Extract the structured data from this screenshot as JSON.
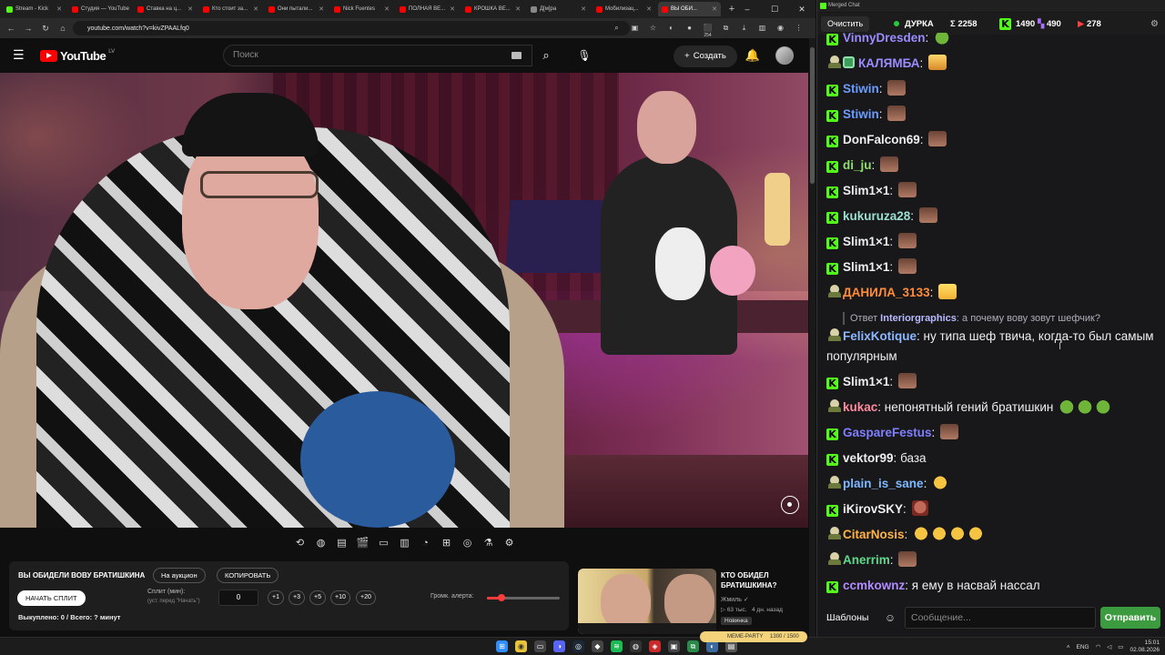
{
  "browser": {
    "tabs": [
      {
        "label": "Stream - Kick",
        "color": "#53fc18"
      },
      {
        "label": "Студия — YouTube",
        "color": "#ff0000"
      },
      {
        "label": "Ставка на ц...",
        "color": "#ff0000"
      },
      {
        "label": "Кто стоит за...",
        "color": "#ff0000"
      },
      {
        "label": "Они пытали...",
        "color": "#ff0000"
      },
      {
        "label": "Nick Fuentes",
        "color": "#ff0000"
      },
      {
        "label": "ПОЛНАЯ ВЕ...",
        "color": "#ff0000"
      },
      {
        "label": "КРОШКА ВЕ...",
        "color": "#ff0000"
      },
      {
        "label": "Д[м]ра",
        "color": "#888888"
      },
      {
        "label": "Мобилизац...",
        "color": "#ff0000"
      },
      {
        "label": "ВЫ ОБИ...",
        "color": "#ff0000"
      }
    ],
    "url": "youtube.com/watch?v=kivZPAALfq0",
    "ext_count": "254"
  },
  "youtube": {
    "logo": "YouTube",
    "country": "LV",
    "search_placeholder": "Поиск",
    "create_label": "Создать"
  },
  "panel": {
    "title": "ВЫ ОБИДЕЛИ ВОВУ БРАТИШКИНА",
    "auction_label": "На аукцион",
    "copy_label": "КОПИРОВАТЬ",
    "start_label": "НАЧАТЬ СПЛИТ",
    "split_label": "Сплит (мин):",
    "split_hint": "(уст. перед \"Начать\")",
    "split_value": "0",
    "steps": [
      "+1",
      "+3",
      "+5",
      "+10",
      "+20"
    ],
    "volume_label": "Громк. алерта:",
    "volume": 0.2,
    "status": "Выкуплено: 0 / Всего: ? минут"
  },
  "recommendation": {
    "title": "КТО ОБИДЕЛ БРАТИШКИНА?",
    "channel": "Жмиль",
    "views": "63 тыс.",
    "age": "4 дн. назад",
    "badge": "Новинка"
  },
  "chat": {
    "window_title": "Merged Chat",
    "clear_label": "Очистить",
    "channel": "ДУРКА",
    "total": "Σ 2258",
    "kick": "1490",
    "twitch": "490",
    "other": "278",
    "templates_label": "Шаблоны",
    "input_placeholder": "Сообщение...",
    "send_label": "Отправить",
    "messages": [
      {
        "user": "VinnyDresden",
        "color": "#9b8cff",
        "badge": "kick",
        "text": "",
        "emotes": [
          "frog"
        ]
      },
      {
        "user": "КАЛЯМБА",
        "color": "#9b8cff",
        "badge": "mod",
        "text": "",
        "emotes": [
          "gold"
        ]
      },
      {
        "user": "Stiwin",
        "color": "#6b9cff",
        "badge": "kick",
        "text": "",
        "emotes": [
          "face"
        ]
      },
      {
        "user": "Stiwin",
        "color": "#6b9cff",
        "badge": "kick",
        "text": "",
        "emotes": [
          "face"
        ]
      },
      {
        "user": "DonFalcon69",
        "color": "#efeff1",
        "badge": "kick",
        "text": "",
        "emotes": [
          "face"
        ]
      },
      {
        "user": "di_ju",
        "color": "#8fe06a",
        "badge": "kick",
        "text": "",
        "emotes": [
          "face"
        ]
      },
      {
        "user": "Slim1×1",
        "color": "#efeff1",
        "badge": "kick",
        "text": "",
        "emotes": [
          "face"
        ]
      },
      {
        "user": "kukuruza28",
        "color": "#9be1d0",
        "badge": "kick",
        "text": "",
        "emotes": [
          "face"
        ]
      },
      {
        "user": "Slim1×1",
        "color": "#efeff1",
        "badge": "kick",
        "text": "",
        "emotes": [
          "face"
        ]
      },
      {
        "user": "Slim1×1",
        "color": "#efeff1",
        "badge": "kick",
        "text": "",
        "emotes": [
          "face"
        ]
      },
      {
        "user": "ДАНИЛА_3133",
        "color": "#ff8c3a",
        "badge": "sub",
        "text": "",
        "emotes": [
          "wink"
        ]
      },
      {
        "user": "FelixKotique",
        "color": "#8bb8ff",
        "badge": "sub",
        "text": "ну типа шеф твича, когда-то был самым популярным",
        "emotes": [],
        "reply_prefix": "Ответ",
        "reply_user": "Interiorgraphics",
        "reply_text": "а почему вову зовут шефчик?"
      },
      {
        "user": "Slim1×1",
        "color": "#efeff1",
        "badge": "kick",
        "text": "",
        "emotes": [
          "face"
        ]
      },
      {
        "user": "kukac",
        "color": "#ff8aa0",
        "badge": "sub",
        "text": "непонятный  гений братишкин",
        "emotes": [
          "frog",
          "frog",
          "frog"
        ]
      },
      {
        "user": "GaspareFestus",
        "color": "#7f7fff",
        "badge": "kick",
        "text": "",
        "emotes": [
          "face"
        ]
      },
      {
        "user": "vektor99",
        "color": "#efeff1",
        "badge": "kick",
        "text": "база",
        "emotes": []
      },
      {
        "user": "plain_is_sane",
        "color": "#7fb8ff",
        "badge": "sub",
        "text": "",
        "emotes": [
          "laugh"
        ]
      },
      {
        "user": "iKirovSKY",
        "color": "#efeff1",
        "badge": "kick",
        "text": "",
        "emotes": [
          "beard"
        ]
      },
      {
        "user": "CitarNosis",
        "color": "#ffb347",
        "badge": "sub",
        "text": "",
        "emotes": [
          "laugh",
          "laugh",
          "laugh",
          "laugh"
        ]
      },
      {
        "user": "Anerrim",
        "color": "#5fd98a",
        "badge": "sub",
        "text": "",
        "emotes": [
          "face"
        ]
      },
      {
        "user": "ccmkownz",
        "color": "#b08cff",
        "badge": "kick",
        "text": "я ему в насвай нассал",
        "emotes": []
      }
    ]
  },
  "taskbar": {
    "lang": "ENG",
    "time": "15:01",
    "date": "02.08.2026",
    "badge_text": "МЕМЕ-PARTY",
    "badge_count": "1300 / 1500"
  }
}
